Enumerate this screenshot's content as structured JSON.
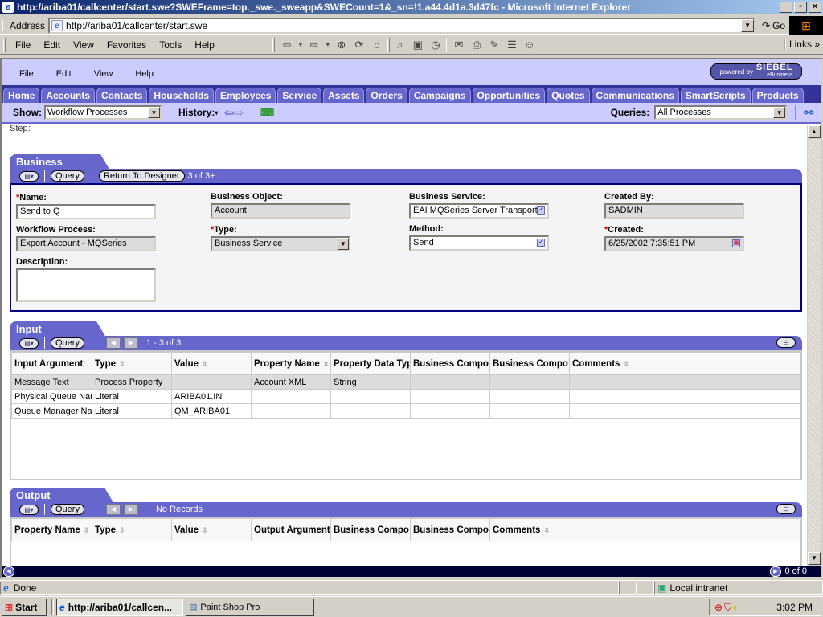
{
  "browser": {
    "window_title": "http://ariba01/callcenter/start.swe?SWEFrame=top._swe._sweapp&SWECount=1&_sn=!1.a44.4d1a.3d47fc - Microsoft Internet Explorer",
    "address_label": "Address",
    "address_value": "http://ariba01/callcenter/start.swe",
    "go_label": "Go",
    "menu": [
      "File",
      "Edit",
      "View",
      "Favorites",
      "Tools",
      "Help"
    ],
    "links_label": "Links",
    "toolbar_icons": [
      "back-icon",
      "forward-icon",
      "stop-icon",
      "refresh-icon",
      "home-icon",
      "search-icon",
      "favorites-icon",
      "history-icon",
      "mail-icon",
      "print-icon",
      "edit-icon",
      "discuss-icon",
      "messenger-icon"
    ],
    "status_text": "Done",
    "zone_text": "Local intranet"
  },
  "siebel": {
    "menu": [
      "File",
      "Edit",
      "View",
      "Help"
    ],
    "powered_by": "powered by",
    "brand": "SIEBEL",
    "brand_sub": "eBusiness",
    "tabs": [
      "Home",
      "Accounts",
      "Contacts",
      "Households",
      "Employees",
      "Service",
      "Assets",
      "Orders",
      "Campaigns",
      "Opportunities",
      "Quotes",
      "Communications",
      "SmartScripts",
      "Products"
    ],
    "show_label": "Show:",
    "show_value": "Workflow Processes",
    "history_label": "History:",
    "queries_label": "Queries:",
    "queries_value": "All Processes",
    "step_label": "Step:"
  },
  "business_service": {
    "title": "Business Service",
    "query_label": "Query",
    "return_label": "Return To Designer",
    "record_count": "3 of 3+",
    "fields": {
      "name_label": "Name:",
      "name_value": "Send to Q",
      "workflow_process_label": "Workflow Process:",
      "workflow_process_value": "Export Account - MQSeries",
      "description_label": "Description:",
      "description_value": "",
      "business_object_label": "Business Object:",
      "business_object_value": "Account",
      "type_label": "Type:",
      "type_value": "Business Service",
      "business_service_label": "Business Service:",
      "business_service_value": "EAI MQSeries Server Transport",
      "method_label": "Method:",
      "method_value": "Send",
      "created_by_label": "Created By:",
      "created_by_value": "SADMIN",
      "created_label": "Created:",
      "created_value": "6/25/2002 7:35:51 PM"
    }
  },
  "input_arguments": {
    "title": "Input Arguments",
    "query_label": "Query",
    "record_count": "1 - 3 of 3",
    "columns": [
      "Input Argument",
      "Type",
      "Value",
      "Property Name",
      "Property Data Typ",
      "Business Compo",
      "Business Compo",
      "Comments"
    ],
    "rows": [
      [
        "Message Text",
        "Process Property",
        "",
        "Account XML",
        "String",
        "",
        "",
        ""
      ],
      [
        "Physical Queue Nam",
        "Literal",
        "ARIBA01.IN",
        "",
        "",
        "",
        "",
        ""
      ],
      [
        "Queue Manager Nar",
        "Literal",
        "QM_ARIBA01",
        "",
        "",
        "",
        "",
        ""
      ]
    ]
  },
  "output_arguments": {
    "title": "Output Arguments",
    "query_label": "Query",
    "record_count": "No Records",
    "columns": [
      "Property Name",
      "Type",
      "Value",
      "Output Argument",
      "Business Compo",
      "Business Compo",
      "Comments"
    ]
  },
  "bottom_bar": {
    "count": "0 of 0"
  },
  "taskbar": {
    "start_label": "Start",
    "items": [
      "http://ariba01/callcen...",
      "Paint Shop Pro"
    ],
    "clock": "3:02 PM"
  }
}
